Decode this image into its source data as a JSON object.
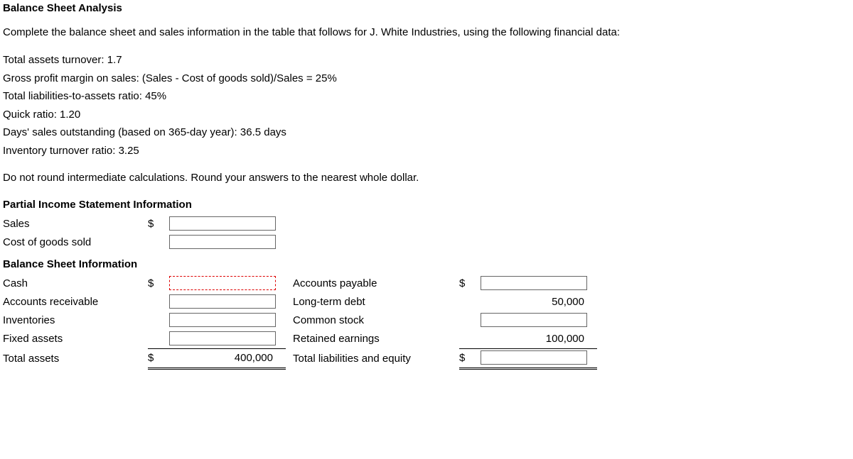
{
  "title": "Balance Sheet Analysis",
  "instructions": "Complete the balance sheet and sales information in the table that follows for J. White Industries, using the following financial data:",
  "financialData": {
    "line1": "Total assets turnover: 1.7",
    "line2": "Gross profit margin on sales: (Sales - Cost of goods sold)/Sales = 25%",
    "line3": "Total liabilities-to-assets ratio: 45%",
    "line4": "Quick ratio: 1.20",
    "line5": "Days' sales outstanding (based on 365-day year): 36.5 days",
    "line6": "Inventory turnover ratio: 3.25"
  },
  "note": "Do not round intermediate calculations. Round your answers to the nearest whole dollar.",
  "incomeHeader": "Partial Income Statement Information",
  "balanceHeader": "Balance Sheet Information",
  "labels": {
    "sales": "Sales",
    "cogs": "Cost of goods sold",
    "cash": "Cash",
    "ar": "Accounts receivable",
    "inventories": "Inventories",
    "fixedAssets": "Fixed assets",
    "totalAssets": "Total assets",
    "ap": "Accounts payable",
    "ltd": "Long-term debt",
    "commonStock": "Common stock",
    "retainedEarnings": "Retained earnings",
    "totalLiabEquity": "Total liabilities and equity"
  },
  "dollar": "$",
  "given": {
    "totalAssets": "400,000",
    "longTermDebt": "50,000",
    "retainedEarnings": "100,000"
  },
  "inputs": {
    "sales": "",
    "cogs": "",
    "cash": "",
    "ar": "",
    "inventories": "",
    "fixedAssets": "",
    "ap": "",
    "commonStock": "",
    "totalLiabEquity": ""
  }
}
